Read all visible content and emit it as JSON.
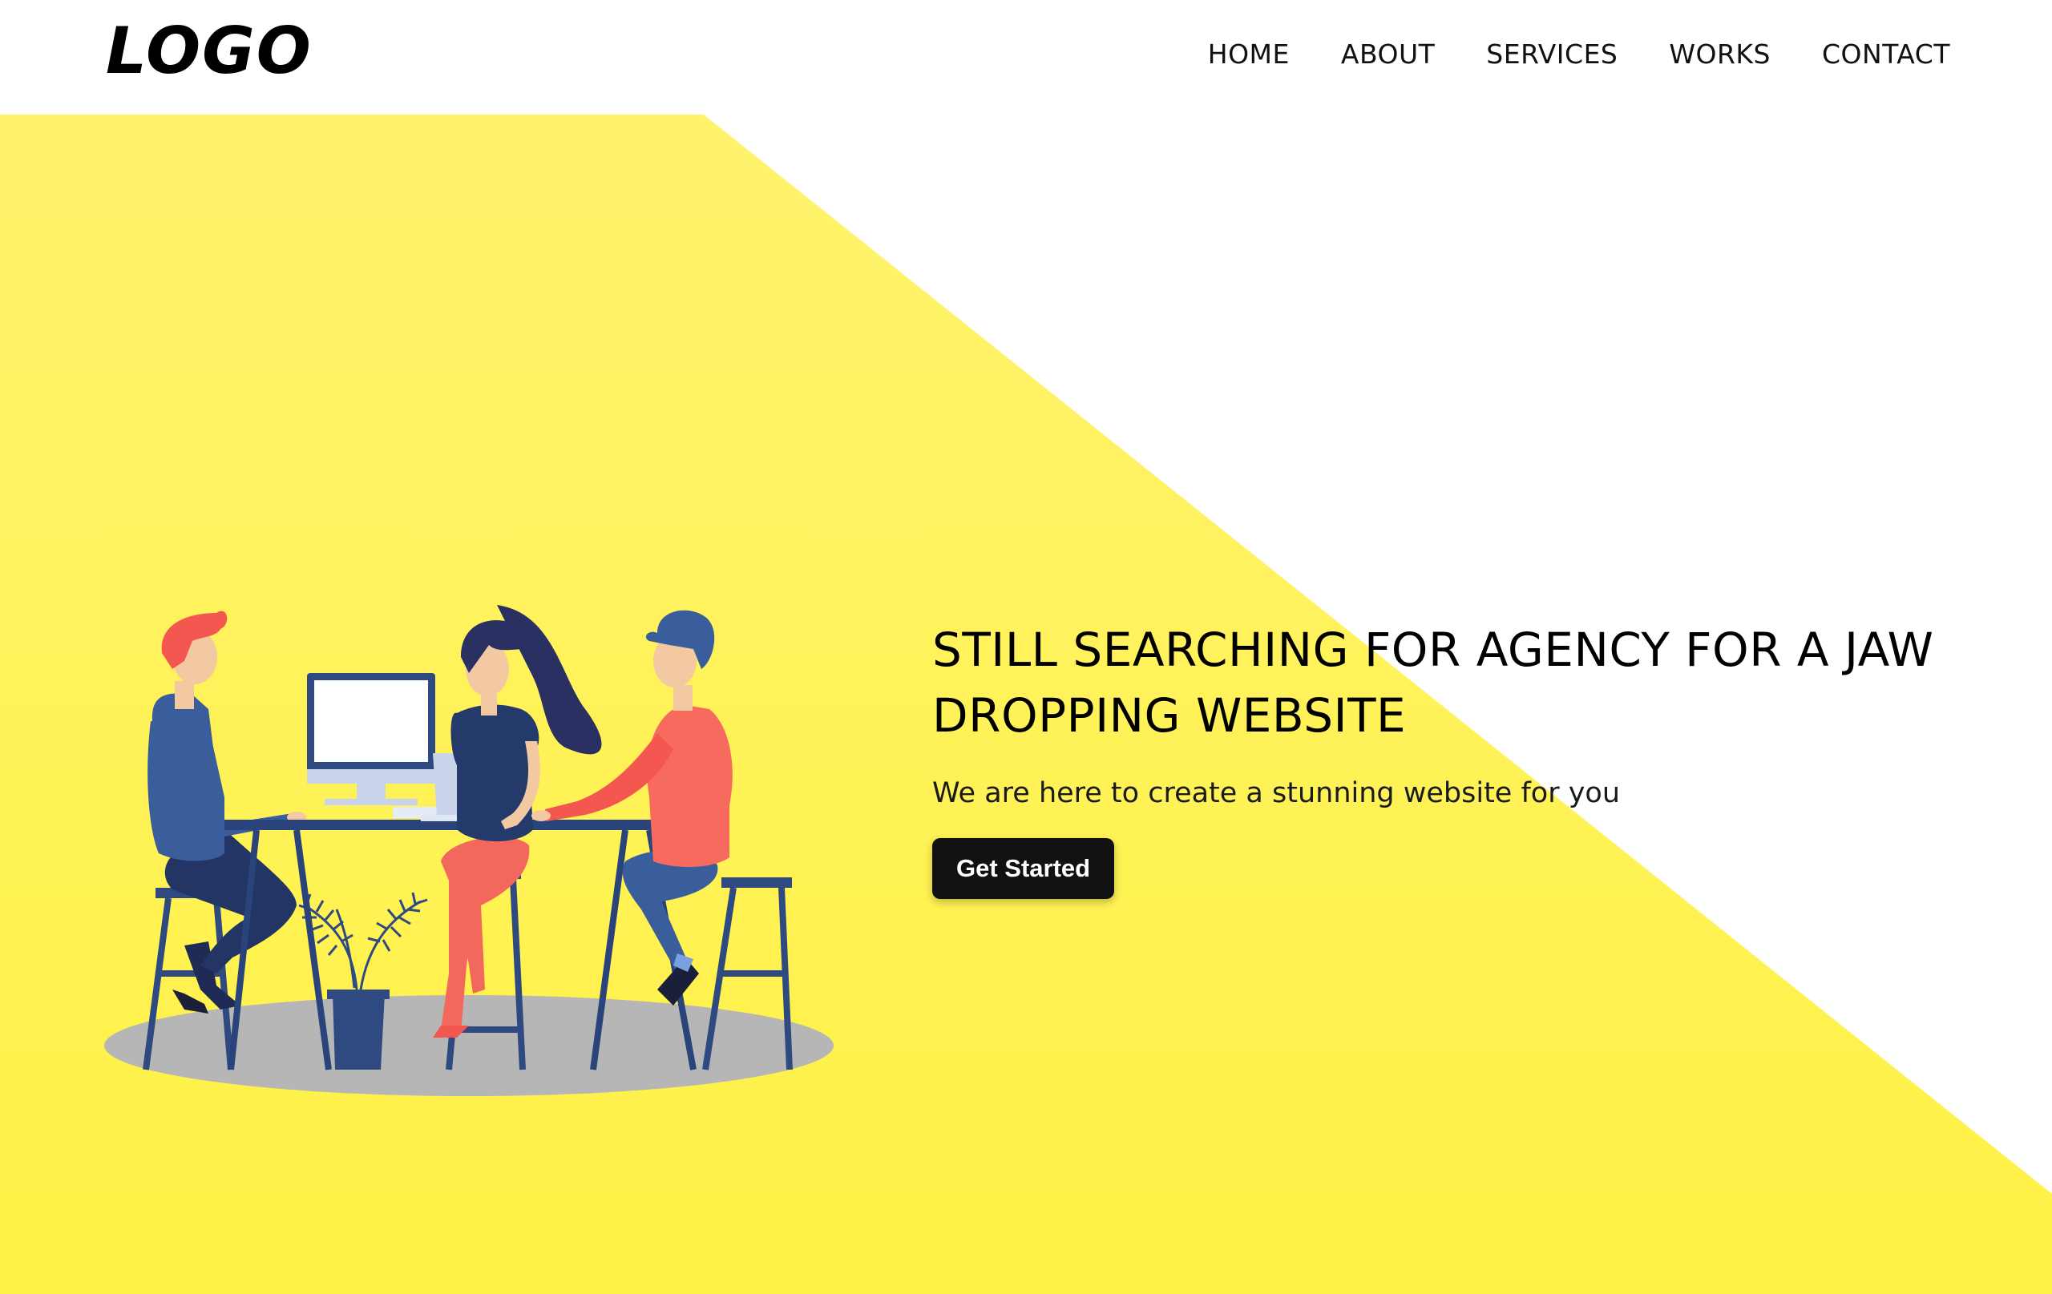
{
  "header": {
    "logo_text": "LOGO",
    "nav": [
      {
        "label": "HOME"
      },
      {
        "label": "ABOUT"
      },
      {
        "label": "SERVICES"
      },
      {
        "label": "WORKS"
      },
      {
        "label": "CONTACT"
      }
    ]
  },
  "hero": {
    "title": "STILL SEARCHING FOR AGENCY FOR A JAW DROPPING WEBSITE",
    "subtitle": "We are here to create a stunning website for you",
    "cta_label": "Get Started"
  },
  "colors": {
    "accent_yellow": "#fff35a",
    "button_bg": "#111111",
    "text": "#000000"
  },
  "icons": {
    "illustration": "team-working-at-desk-illustration"
  }
}
